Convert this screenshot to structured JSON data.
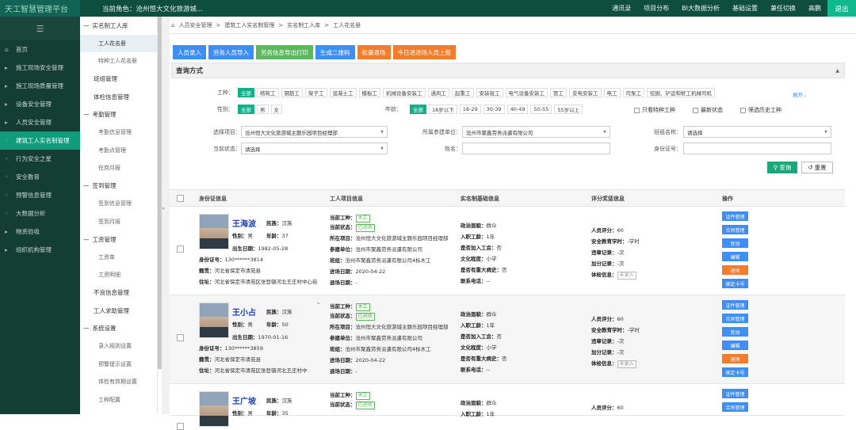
{
  "topbar": {
    "brand": "天工智慧管理平台",
    "role": "当前角色：沧州恒大文化旅游城...",
    "nav": [
      "通讯录",
      "项目分布",
      "BI大数据分析",
      "基础设置",
      "兼任切换",
      "高鹏"
    ],
    "logout": "退出"
  },
  "sidebar": {
    "items": [
      {
        "label": "首页",
        "icon": "home-icon",
        "arrow": ""
      },
      {
        "label": "施工现场安全管理",
        "icon": "",
        "arrow": "›"
      },
      {
        "label": "施工现场质量管理",
        "icon": "",
        "arrow": "›"
      },
      {
        "label": "设备安全管理",
        "icon": "",
        "arrow": "›"
      },
      {
        "label": "人员安全管理",
        "icon": "",
        "arrow": "⌄"
      },
      {
        "label": "建筑工人实名制管理",
        "icon": "",
        "arrow": ""
      },
      {
        "label": "行为安全之星",
        "icon": "",
        "arrow": ""
      },
      {
        "label": "安全教育",
        "icon": "",
        "arrow": ""
      },
      {
        "label": "预警信息管理",
        "icon": "",
        "arrow": ""
      },
      {
        "label": "大数据分析",
        "icon": "",
        "arrow": ""
      },
      {
        "label": "物资验收",
        "icon": "",
        "arrow": "›"
      },
      {
        "label": "组织机构管理",
        "icon": "",
        "arrow": "›"
      }
    ]
  },
  "subnav": {
    "items": [
      {
        "type": "g",
        "label": "实名制工人库"
      },
      {
        "type": "c",
        "label": "工人花名册",
        "active": true
      },
      {
        "type": "c",
        "label": "特种工人花名册"
      },
      {
        "type": "n",
        "label": "班组管理"
      },
      {
        "type": "n",
        "label": "体检信息管理"
      },
      {
        "type": "g",
        "label": "考勤管理"
      },
      {
        "type": "c",
        "label": "考勤信息管理"
      },
      {
        "type": "c",
        "label": "考勤点管理"
      },
      {
        "type": "c",
        "label": "在岗月报"
      },
      {
        "type": "g",
        "label": "签到管理"
      },
      {
        "type": "c",
        "label": "签到信息管理"
      },
      {
        "type": "c",
        "label": "签到月报"
      },
      {
        "type": "g",
        "label": "工资管理"
      },
      {
        "type": "c",
        "label": "工资单"
      },
      {
        "type": "c",
        "label": "工资明细"
      },
      {
        "type": "n",
        "label": "不良信息管理"
      },
      {
        "type": "n",
        "label": "工人求助管理"
      },
      {
        "type": "g",
        "label": "系统设置"
      },
      {
        "type": "c",
        "label": "录入规则设置"
      },
      {
        "type": "c",
        "label": "预警提示设置"
      },
      {
        "type": "c",
        "label": "体检有效期设置"
      },
      {
        "type": "c",
        "label": "工种配置"
      }
    ]
  },
  "breadcrumb": [
    "人员安全管理",
    "建筑工人实名制管理",
    "实名制工人库",
    "工人花名册"
  ],
  "actions": [
    {
      "label": "人员录入",
      "c": "b-blue"
    },
    {
      "label": "劳务人员导入",
      "c": "b-blue"
    },
    {
      "label": "劳务信息导出打印",
      "c": "b-green"
    },
    {
      "label": "生成二维码",
      "c": "b-blue"
    },
    {
      "label": "批量退场",
      "c": "b-orange"
    },
    {
      "label": "今日进退场人员上报",
      "c": "b-orange"
    }
  ],
  "query": {
    "title": "查询方式",
    "trade_label": "工种：",
    "trades": [
      "全部",
      "砌筑工",
      "钢筋工",
      "架子工",
      "混凝土工",
      "模板工",
      "机械设备安装工",
      "通风工",
      "起重工",
      "安装钳工",
      "电气设备安装工",
      "管工",
      "变电安装工",
      "电工",
      "司泵工",
      "挖掘、铲运和桩工机械司机"
    ],
    "expand": "展开⌄",
    "gender_label": "性别：",
    "genders": [
      "全部",
      "男",
      "女"
    ],
    "age_label": "年龄：",
    "ages": [
      "全部",
      "18岁以下",
      "18-29",
      "30-39",
      "40-49",
      "50-55",
      "55岁以上"
    ],
    "checks": [
      "只看特种工种",
      "最新状态",
      "筛选历史工种"
    ],
    "project_label": "选择项目：",
    "project": "沧州恒大文化旅游城主题乐园项目经理部",
    "unit_label": "所属参建单位：",
    "unit": "沧州市聚鑫劳务派遣有限公司",
    "team_label": "班组名称：",
    "team": "请选择",
    "status_label": "当前状态：",
    "status": "请选择",
    "name_label": "姓名：",
    "id_label": "身份证号：",
    "search": "查询",
    "reset": "重置"
  },
  "table": {
    "headers": [
      "身份证信息",
      "工人项目信息",
      "实名制基础信息",
      "评分奖惩信息",
      "操作"
    ],
    "ops": [
      "证件管理",
      "合同管理",
      "变动",
      "编辑",
      "退场",
      "绑定卡号"
    ],
    "rows": [
      {
        "name": "王海波",
        "nation": "汉族",
        "gender": "男",
        "age": "37",
        "birth": "1982-05-28",
        "idno": "130******3814",
        "origin": "河北省保定市清苑县",
        "addr": "河北省保定市清苑区张登镇河北王庄村中心街",
        "trade": "木工",
        "state": "已进场",
        "project": "沧州恒大文化旅游城主题乐园项目经理部",
        "unit": "沧州市聚鑫劳务派遣有限公司",
        "team": "沧州市聚鑫劳务派遣有限公司4标木工",
        "enter": "2020-04-22",
        "exit": "-",
        "political": "群众",
        "year": "1年",
        "union": "否",
        "edu": "小学",
        "disease": "否",
        "phone": "--",
        "score": "60",
        "study": "-学时",
        "viol": "-次",
        "bonus": "-次",
        "health": "未录入"
      },
      {
        "name": "王小占",
        "nation": "汉族",
        "gender": "男",
        "age": "50",
        "birth": "1970-01-16",
        "idno": "130******3859",
        "origin": "河北省保定市清苑县",
        "addr": "河北省保定市清苑区张登镇河北王庄村中",
        "trade": "木工",
        "state": "已进场",
        "project": "沧州恒大文化旅游城主题乐园项目经理部",
        "unit": "沧州市聚鑫劳务派遣有限公司",
        "team": "沧州市聚鑫劳务派遣有限公司4标木工",
        "enter": "2020-04-22",
        "exit": "-",
        "political": "群众",
        "year": "1年",
        "union": "否",
        "edu": "小学",
        "disease": "否",
        "phone": "--",
        "score": "60",
        "study": "-学时",
        "viol": "-次",
        "bonus": "-次",
        "health": "未录入"
      },
      {
        "name": "王广坡",
        "nation": "汉族",
        "gender": "男",
        "age": "35",
        "trade": "木工",
        "state": "已进场",
        "political": "群众",
        "year": "1年",
        "score": "60"
      }
    ],
    "labels": {
      "nation": "民族：",
      "gender": "性别：",
      "age": "年龄：",
      "birth": "出生日期：",
      "idno": "身份证号：",
      "origin": "籍贯：",
      "addr": "住址：",
      "trade": "当前工种：",
      "state": "当前状态：",
      "project": "所在项目：",
      "unit": "参建单位：",
      "team": "班组：",
      "enter": "进场日期：",
      "exit": "退场日期：",
      "political": "政治面貌：",
      "year": "入职工龄：",
      "union": "是否加入工会：",
      "edu": "文化程度：",
      "disease": "是否有重大病史：",
      "phone": "联系电话：",
      "score": "人员评分：",
      "study": "安全教育学时：",
      "viol": "违章记录：",
      "bonus": "加分记录：",
      "health": "体检信息："
    }
  }
}
